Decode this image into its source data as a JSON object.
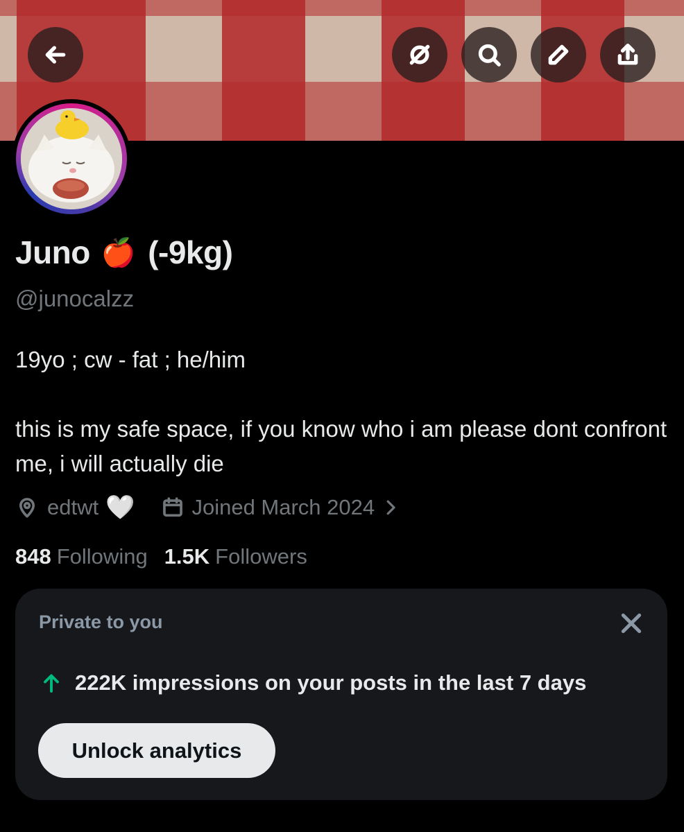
{
  "header": {
    "back_icon": "arrow-left-icon",
    "actions": [
      {
        "icon": "grok-icon"
      },
      {
        "icon": "search-icon"
      },
      {
        "icon": "pencil-icon"
      },
      {
        "icon": "share-icon"
      }
    ]
  },
  "profile": {
    "display_name": "Juno",
    "name_emoji": "🍎",
    "name_suffix": "(-9kg)",
    "handle": "@junocalzz",
    "bio": "19yo ; cw - fat ; he/him\n\nthis is my safe space, if you know who i am please dont confront me, i will actually die",
    "location": "edtwt",
    "location_emoji": "🤍",
    "joined": "Joined March 2024",
    "following_count": "848",
    "following_label": "Following",
    "followers_count": "1.5K",
    "followers_label": "Followers"
  },
  "analytics_card": {
    "label": "Private to you",
    "impressions_text": "222K impressions on your posts in the last 7 days",
    "button_label": "Unlock analytics",
    "trend_color": "#00ba7c"
  }
}
